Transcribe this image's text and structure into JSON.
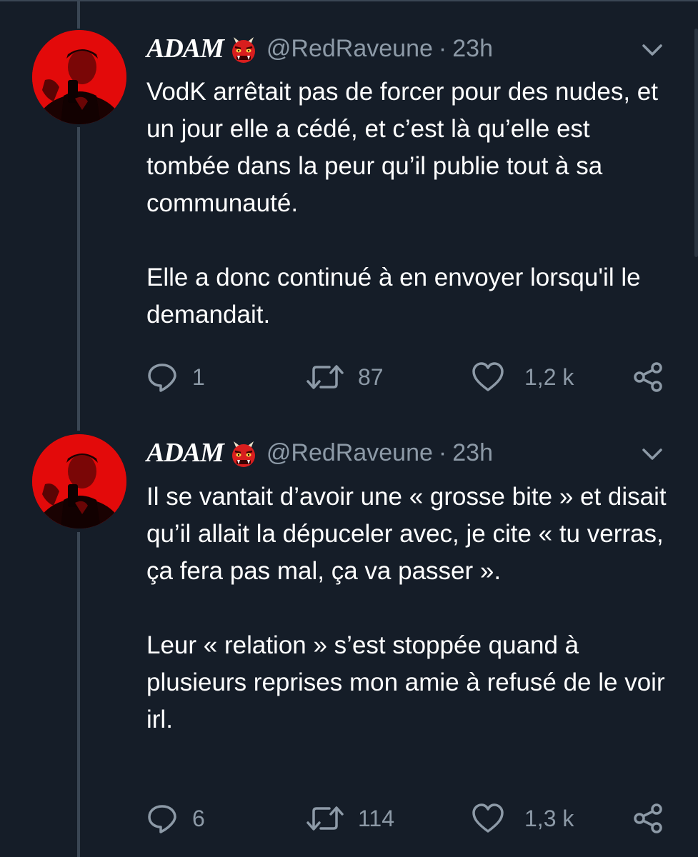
{
  "tweets": [
    {
      "display_name": "ADAM",
      "name_emoji": "ogre-emoji",
      "handle": "@RedRaveune",
      "separator": "·",
      "time": "23h",
      "paragraphs": [
        "VodK arrêtait pas de forcer pour des nudes, et un jour elle a cédé, et c’est là qu’elle est tombée dans la peur qu’il publie tout à sa communauté.",
        "Elle a donc continué à en envoyer lorsqu'il le demandait."
      ],
      "replies": "1",
      "retweets": "87",
      "likes": "1,2 k"
    },
    {
      "display_name": "ADAM",
      "name_emoji": "ogre-emoji",
      "handle": "@RedRaveune",
      "separator": "·",
      "time": "23h",
      "paragraphs": [
        "Il se vantait d’avoir une « grosse bite » et disait qu’il allait la dépuceler avec, je cite « tu verras, ça fera pas mal, ça va passer ».",
        "Leur « relation » s’est stoppée quand à plusieurs reprises mon amie à refusé de le voir irl."
      ],
      "replies": "6",
      "retweets": "114",
      "likes": "1,3 k"
    }
  ],
  "icons": {
    "reply": "speech-bubble-icon",
    "retweet": "retweet-icon",
    "like": "heart-icon",
    "share": "share-icon",
    "menu": "chevron-down-icon"
  },
  "colors": {
    "background": "#151d28",
    "text": "#ffffff",
    "muted": "#8d9aa7",
    "thread_line": "#3a4654",
    "avatar_red": "#e00000"
  }
}
